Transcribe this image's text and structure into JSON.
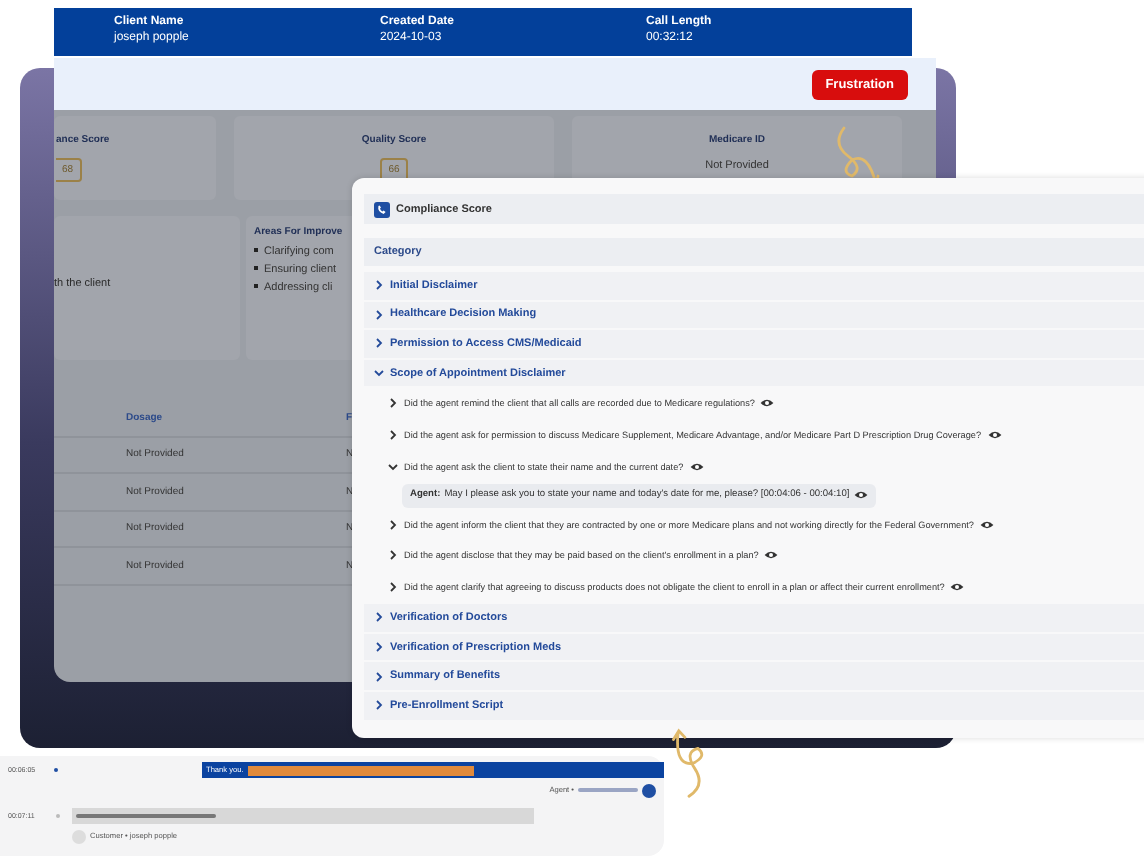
{
  "call_header": {
    "fields": [
      {
        "label": "Client Name",
        "value": "joseph popple"
      },
      {
        "label": "Created Date",
        "value": "2024-10-03"
      },
      {
        "label": "Call Length",
        "value": "00:32:12"
      }
    ]
  },
  "dashboard": {
    "sentiment_tag": "Frustration",
    "scores": [
      {
        "label": "ance Score",
        "value": "68"
      },
      {
        "label": "Quality Score",
        "value": "66"
      }
    ],
    "medicare": {
      "label": "Medicare ID",
      "value": "Not Provided"
    },
    "summary_fragment": "th the client",
    "improvements": {
      "title": "Areas For Improve",
      "items": [
        "Clarifying com",
        "Ensuring client",
        "Addressing cli"
      ]
    },
    "medications": {
      "columns": [
        "Dosage",
        "F"
      ],
      "rows": [
        [
          "Not Provided",
          "N"
        ],
        [
          "Not Provided",
          "N"
        ],
        [
          "Not Provided",
          "N"
        ],
        [
          "Not Provided",
          "N"
        ]
      ]
    }
  },
  "compliance": {
    "title": "Compliance Score",
    "header": "Category",
    "categories": [
      {
        "label": "Initial Disclaimer",
        "expanded": false
      },
      {
        "label": "Healthcare Decision Making",
        "expanded": false
      },
      {
        "label": "Permission to Access CMS/Medicaid",
        "expanded": false
      },
      {
        "label": "Scope of Appointment Disclaimer",
        "expanded": true,
        "questions": [
          {
            "text": "Did the agent remind the client that all calls are recorded due to Medicare regulations?",
            "expanded": false
          },
          {
            "text": "Did the agent ask for permission to discuss Medicare Supplement, Medicare Advantage, and/or Medicare Part D Prescription Drug Coverage?",
            "expanded": false
          },
          {
            "text": "Did the agent ask the client to state their name and the current date?",
            "expanded": true,
            "quote": {
              "speaker": "Agent:",
              "text": "May I please ask you to state your name and today's date for me, please? [00:04:06 - 00:04:10]"
            }
          },
          {
            "text": "Did the agent inform the client that they are contracted by one or more Medicare plans and not working directly for the Federal Government?",
            "expanded": false
          },
          {
            "text": "Did the agent disclose that they may be paid based on the client's enrollment in a plan?",
            "expanded": false
          },
          {
            "text": "Did the agent clarify that agreeing to discuss products does not obligate the client to enroll in a plan or affect their current enrollment?",
            "expanded": false
          }
        ]
      },
      {
        "label": "Verification of Doctors",
        "expanded": false
      },
      {
        "label": "Verification of Prescription Meds",
        "expanded": false
      },
      {
        "label": "Summary of Benefits",
        "expanded": false
      },
      {
        "label": "Pre-Enrollment Script",
        "expanded": false
      }
    ]
  },
  "transcript": {
    "entries": [
      {
        "kind": "agent",
        "time": "00:06:05",
        "text": "Thank you.",
        "speaker": "Agent •"
      },
      {
        "kind": "customer",
        "time": "00:07:11",
        "speaker": "Customer • joseph popple"
      }
    ]
  }
}
